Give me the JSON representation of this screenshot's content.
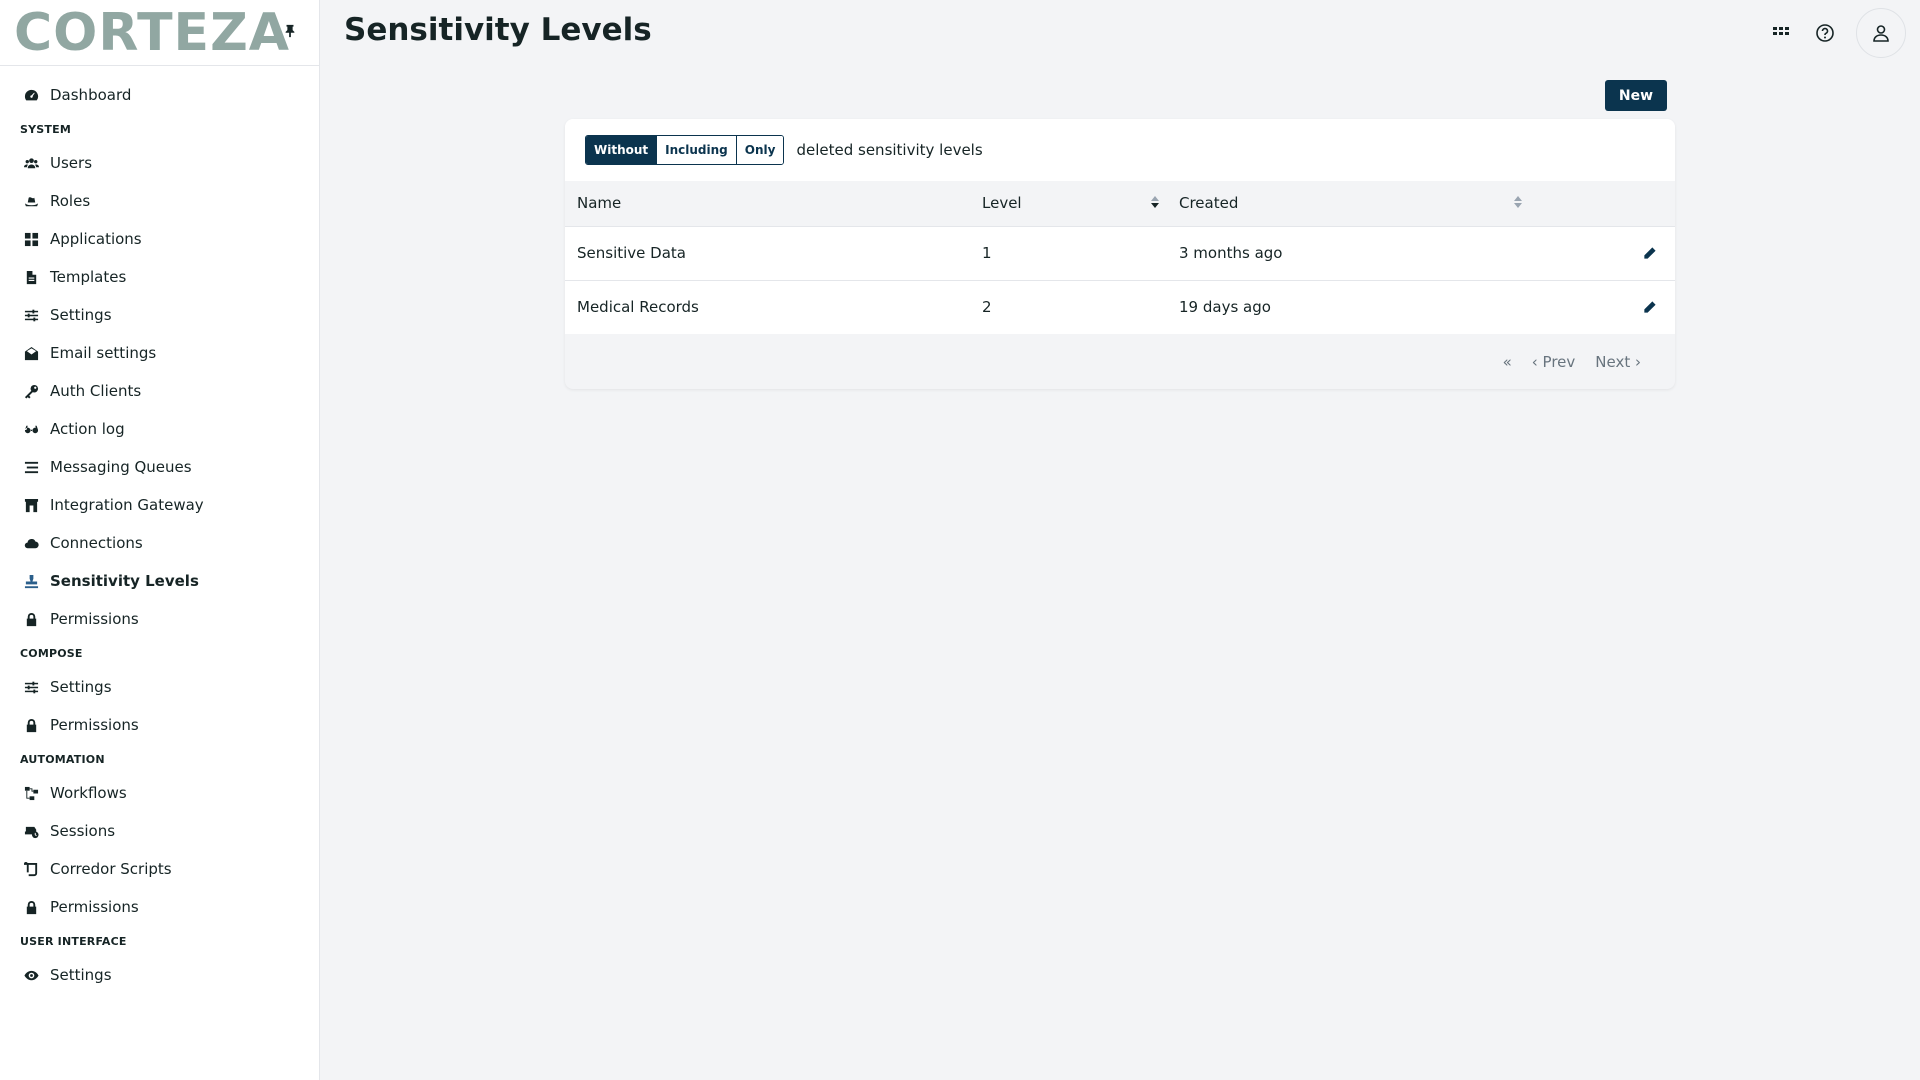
{
  "brand": {
    "logo_text": "CORTEZA"
  },
  "header": {
    "title": "Sensitivity Levels"
  },
  "sidebar": {
    "dashboard": "Dashboard",
    "system_title": "SYSTEM",
    "system": [
      {
        "label": "Users",
        "icon": "users-icon"
      },
      {
        "label": "Roles",
        "icon": "hat-icon"
      },
      {
        "label": "Applications",
        "icon": "grid-icon"
      },
      {
        "label": "Templates",
        "icon": "file-icon"
      },
      {
        "label": "Settings",
        "icon": "sliders-icon"
      },
      {
        "label": "Email settings",
        "icon": "envelope-icon"
      },
      {
        "label": "Auth Clients",
        "icon": "key-icon"
      },
      {
        "label": "Action log",
        "icon": "glasses-icon"
      },
      {
        "label": "Messaging Queues",
        "icon": "list-icon"
      },
      {
        "label": "Integration Gateway",
        "icon": "gateway-icon"
      },
      {
        "label": "Connections",
        "icon": "cloud-icon"
      },
      {
        "label": "Sensitivity Levels",
        "icon": "stamp-icon"
      },
      {
        "label": "Permissions",
        "icon": "lock-icon"
      }
    ],
    "compose_title": "COMPOSE",
    "compose": [
      {
        "label": "Settings",
        "icon": "sliders-icon"
      },
      {
        "label": "Permissions",
        "icon": "lock-icon"
      }
    ],
    "automation_title": "AUTOMATION",
    "automation": [
      {
        "label": "Workflows",
        "icon": "workflow-icon"
      },
      {
        "label": "Sessions",
        "icon": "sessions-icon"
      },
      {
        "label": "Corredor Scripts",
        "icon": "scroll-icon"
      },
      {
        "label": "Permissions",
        "icon": "lock-icon"
      }
    ],
    "ui_title": "USER INTERFACE",
    "ui": [
      {
        "label": "Settings",
        "icon": "eye-icon"
      }
    ]
  },
  "toolbar": {
    "new_label": "New"
  },
  "filter": {
    "options": [
      "Without",
      "Including",
      "Only"
    ],
    "selected": "Without",
    "label": "deleted sensitivity levels"
  },
  "table": {
    "columns": [
      "Name",
      "Level",
      "Created"
    ],
    "rows": [
      {
        "name": "Sensitive Data",
        "level": "1",
        "created": "3 months ago"
      },
      {
        "name": "Medical Records",
        "level": "2",
        "created": "19 days ago"
      }
    ]
  },
  "pager": {
    "first": "«",
    "prev": "‹ Prev",
    "next": "Next ›"
  },
  "colors": {
    "primary": "#0b344e",
    "logo": "#91a7a2",
    "background": "#f3f4f6",
    "active_icon": "#2b5f8b"
  }
}
